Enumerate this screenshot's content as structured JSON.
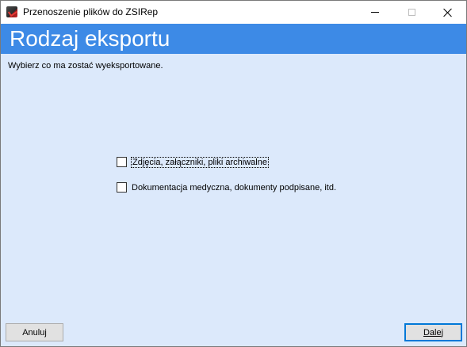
{
  "window": {
    "title": "Przenoszenie plików do ZSIRep",
    "controls": {
      "minimize": "minimize-icon",
      "maximize": "maximize-icon",
      "close": "close-icon"
    }
  },
  "header": {
    "title": "Rodzaj eksportu",
    "color": "#3d8ae6"
  },
  "content": {
    "subtitle": "Wybierz co ma zostać wyeksportowane.",
    "background": "#dce9fb",
    "options": [
      {
        "label": "Zdjęcia, załączniki, pliki archiwalne",
        "checked": false
      },
      {
        "label": "Dokumentacja medyczna, dokumenty podpisane, itd.",
        "checked": false
      }
    ]
  },
  "footer": {
    "cancel_label": "Anuluj",
    "next_label": "Dalej"
  }
}
